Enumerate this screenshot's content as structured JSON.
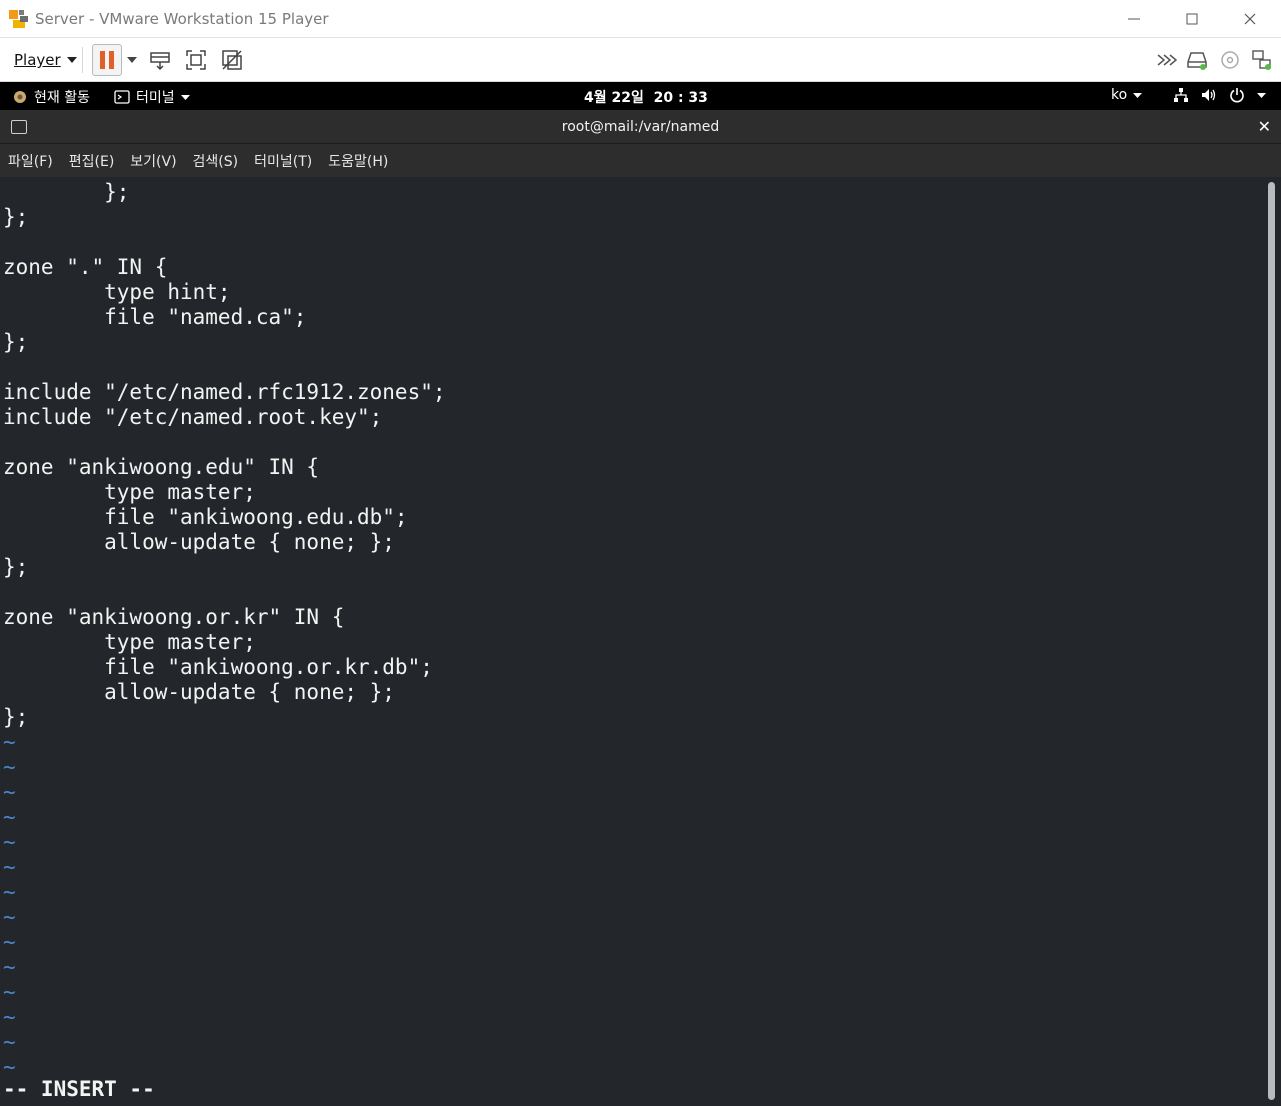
{
  "window": {
    "title": "Server - VMware Workstation 15 Player"
  },
  "toolbar": {
    "player_label": "Player",
    "icons": [
      "pause-icon",
      "send-ctrl-alt-del-icon",
      "fullscreen-icon",
      "unity-icon",
      "forward-icon",
      "hard-disk-icon",
      "cd-icon",
      "network-icon"
    ],
    "accent": "#e0602a"
  },
  "gnome": {
    "activities": "현재 활동",
    "app_menu": "터미널",
    "clock": "4월 22일  20 : 33",
    "input_method": "ko"
  },
  "terminal": {
    "title": "root@mail:/var/named",
    "menus": [
      "파일(F)",
      "편집(E)",
      "보기(V)",
      "검색(S)",
      "터미널(T)",
      "도움말(H)"
    ],
    "lines": [
      "        };",
      "};",
      "",
      "zone \".\" IN {",
      "        type hint;",
      "        file \"named.ca\";",
      "};",
      "",
      "include \"/etc/named.rfc1912.zones\";",
      "include \"/etc/named.root.key\";",
      "",
      "zone \"ankiwoong.edu\" IN {",
      "        type master;",
      "        file \"ankiwoong.edu.db\";",
      "        allow-update { none; };",
      "};",
      "",
      "zone \"ankiwoong.or.kr\" IN {",
      "        type master;",
      "        file \"ankiwoong.or.kr.db\";",
      "        allow-update { none; };",
      "};"
    ],
    "empty_line_marker": "~",
    "empty_line_count": 14,
    "status": "-- INSERT --",
    "colors": {
      "background": "#23272b",
      "text": "#f3f3f3",
      "tilde": "#4a86c8"
    }
  }
}
